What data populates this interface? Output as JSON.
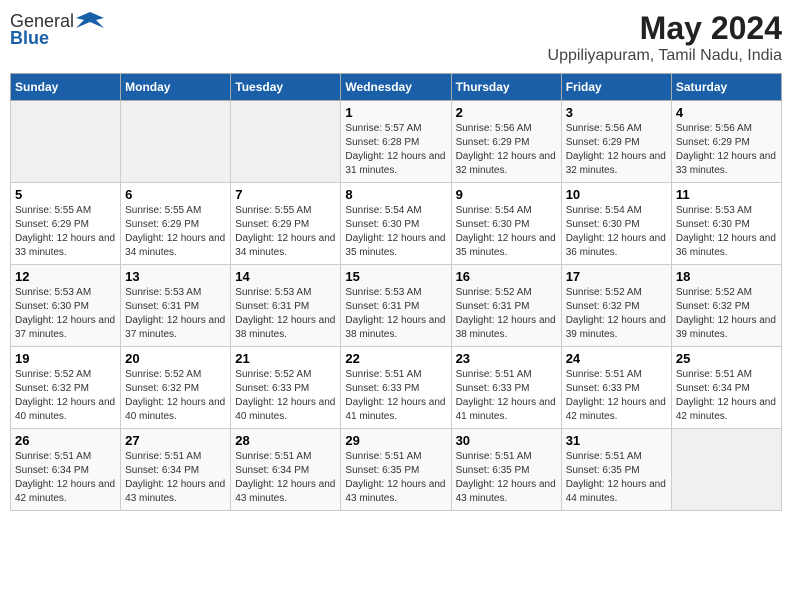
{
  "logo": {
    "general": "General",
    "blue": "Blue"
  },
  "title": "May 2024",
  "subtitle": "Uppiliyapuram, Tamil Nadu, India",
  "days_of_week": [
    "Sunday",
    "Monday",
    "Tuesday",
    "Wednesday",
    "Thursday",
    "Friday",
    "Saturday"
  ],
  "weeks": [
    [
      {
        "day": "",
        "info": ""
      },
      {
        "day": "",
        "info": ""
      },
      {
        "day": "",
        "info": ""
      },
      {
        "day": "1",
        "info": "Sunrise: 5:57 AM\nSunset: 6:28 PM\nDaylight: 12 hours and 31 minutes."
      },
      {
        "day": "2",
        "info": "Sunrise: 5:56 AM\nSunset: 6:29 PM\nDaylight: 12 hours and 32 minutes."
      },
      {
        "day": "3",
        "info": "Sunrise: 5:56 AM\nSunset: 6:29 PM\nDaylight: 12 hours and 32 minutes."
      },
      {
        "day": "4",
        "info": "Sunrise: 5:56 AM\nSunset: 6:29 PM\nDaylight: 12 hours and 33 minutes."
      }
    ],
    [
      {
        "day": "5",
        "info": "Sunrise: 5:55 AM\nSunset: 6:29 PM\nDaylight: 12 hours and 33 minutes."
      },
      {
        "day": "6",
        "info": "Sunrise: 5:55 AM\nSunset: 6:29 PM\nDaylight: 12 hours and 34 minutes."
      },
      {
        "day": "7",
        "info": "Sunrise: 5:55 AM\nSunset: 6:29 PM\nDaylight: 12 hours and 34 minutes."
      },
      {
        "day": "8",
        "info": "Sunrise: 5:54 AM\nSunset: 6:30 PM\nDaylight: 12 hours and 35 minutes."
      },
      {
        "day": "9",
        "info": "Sunrise: 5:54 AM\nSunset: 6:30 PM\nDaylight: 12 hours and 35 minutes."
      },
      {
        "day": "10",
        "info": "Sunrise: 5:54 AM\nSunset: 6:30 PM\nDaylight: 12 hours and 36 minutes."
      },
      {
        "day": "11",
        "info": "Sunrise: 5:53 AM\nSunset: 6:30 PM\nDaylight: 12 hours and 36 minutes."
      }
    ],
    [
      {
        "day": "12",
        "info": "Sunrise: 5:53 AM\nSunset: 6:30 PM\nDaylight: 12 hours and 37 minutes."
      },
      {
        "day": "13",
        "info": "Sunrise: 5:53 AM\nSunset: 6:31 PM\nDaylight: 12 hours and 37 minutes."
      },
      {
        "day": "14",
        "info": "Sunrise: 5:53 AM\nSunset: 6:31 PM\nDaylight: 12 hours and 38 minutes."
      },
      {
        "day": "15",
        "info": "Sunrise: 5:53 AM\nSunset: 6:31 PM\nDaylight: 12 hours and 38 minutes."
      },
      {
        "day": "16",
        "info": "Sunrise: 5:52 AM\nSunset: 6:31 PM\nDaylight: 12 hours and 38 minutes."
      },
      {
        "day": "17",
        "info": "Sunrise: 5:52 AM\nSunset: 6:32 PM\nDaylight: 12 hours and 39 minutes."
      },
      {
        "day": "18",
        "info": "Sunrise: 5:52 AM\nSunset: 6:32 PM\nDaylight: 12 hours and 39 minutes."
      }
    ],
    [
      {
        "day": "19",
        "info": "Sunrise: 5:52 AM\nSunset: 6:32 PM\nDaylight: 12 hours and 40 minutes."
      },
      {
        "day": "20",
        "info": "Sunrise: 5:52 AM\nSunset: 6:32 PM\nDaylight: 12 hours and 40 minutes."
      },
      {
        "day": "21",
        "info": "Sunrise: 5:52 AM\nSunset: 6:33 PM\nDaylight: 12 hours and 40 minutes."
      },
      {
        "day": "22",
        "info": "Sunrise: 5:51 AM\nSunset: 6:33 PM\nDaylight: 12 hours and 41 minutes."
      },
      {
        "day": "23",
        "info": "Sunrise: 5:51 AM\nSunset: 6:33 PM\nDaylight: 12 hours and 41 minutes."
      },
      {
        "day": "24",
        "info": "Sunrise: 5:51 AM\nSunset: 6:33 PM\nDaylight: 12 hours and 42 minutes."
      },
      {
        "day": "25",
        "info": "Sunrise: 5:51 AM\nSunset: 6:34 PM\nDaylight: 12 hours and 42 minutes."
      }
    ],
    [
      {
        "day": "26",
        "info": "Sunrise: 5:51 AM\nSunset: 6:34 PM\nDaylight: 12 hours and 42 minutes."
      },
      {
        "day": "27",
        "info": "Sunrise: 5:51 AM\nSunset: 6:34 PM\nDaylight: 12 hours and 43 minutes."
      },
      {
        "day": "28",
        "info": "Sunrise: 5:51 AM\nSunset: 6:34 PM\nDaylight: 12 hours and 43 minutes."
      },
      {
        "day": "29",
        "info": "Sunrise: 5:51 AM\nSunset: 6:35 PM\nDaylight: 12 hours and 43 minutes."
      },
      {
        "day": "30",
        "info": "Sunrise: 5:51 AM\nSunset: 6:35 PM\nDaylight: 12 hours and 43 minutes."
      },
      {
        "day": "31",
        "info": "Sunrise: 5:51 AM\nSunset: 6:35 PM\nDaylight: 12 hours and 44 minutes."
      },
      {
        "day": "",
        "info": ""
      }
    ]
  ]
}
